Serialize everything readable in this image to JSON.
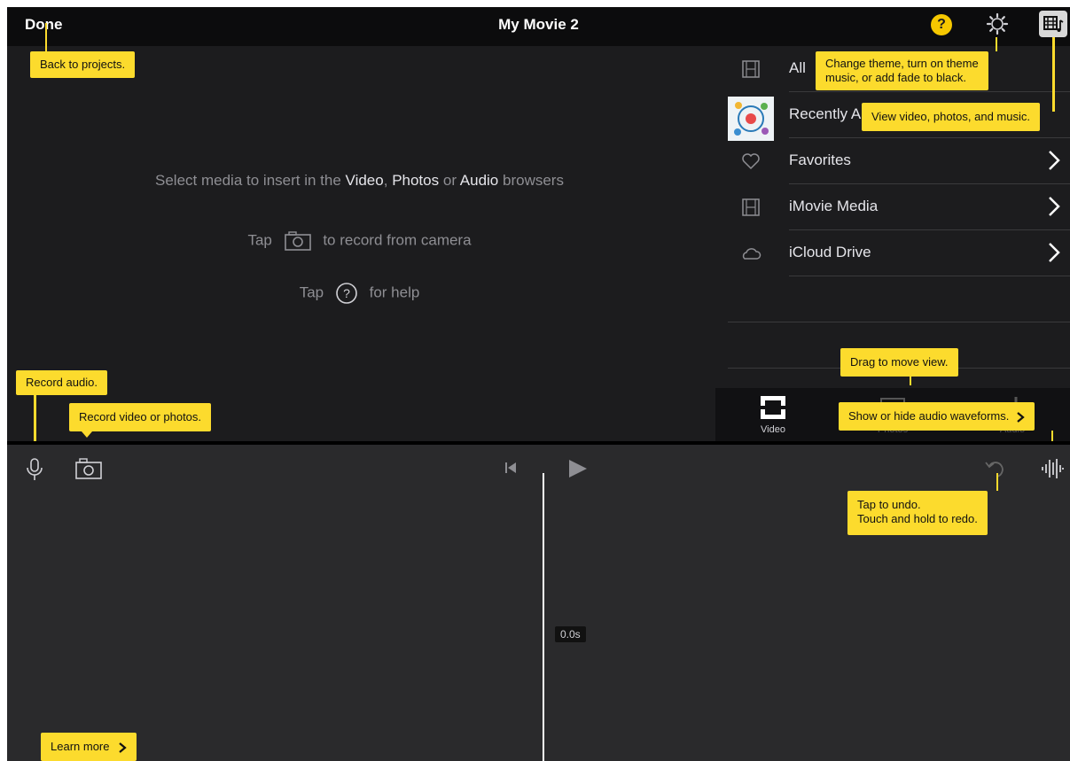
{
  "header": {
    "done_label": "Done",
    "title": "My Movie 2",
    "help_symbol": "?"
  },
  "viewer": {
    "hint_prefix": "Select media to insert in the",
    "hint_video": "Video",
    "hint_sep": ",",
    "hint_photos": "Photos",
    "hint_or": "or",
    "hint_audio": "Audio",
    "hint_suffix": "browsers",
    "camera_tap": "Tap",
    "camera_text": "to record from camera",
    "help_tap": "Tap",
    "help_text": "for help"
  },
  "browser": {
    "items": [
      {
        "label": "All",
        "icon": "film-icon"
      },
      {
        "label": "Recently A",
        "icon": "thumbnail"
      },
      {
        "label": "Favorites",
        "icon": "heart-icon"
      },
      {
        "label": "iMovie Media",
        "icon": "film-icon"
      },
      {
        "label": "iCloud Drive",
        "icon": "cloud-icon"
      }
    ],
    "tabs": [
      {
        "label": "Video",
        "icon": "video-tab-icon"
      },
      {
        "label": "Photos",
        "icon": "photos-tab-icon"
      },
      {
        "label": "Audio",
        "icon": "audio-tab-icon"
      }
    ]
  },
  "timeline": {
    "time": "0.0s"
  },
  "tips": {
    "back": "Back to projects.",
    "theme_line1": "Change theme, turn on theme",
    "theme_line2": "music, or add fade to black.",
    "media": "View video, photos, and music.",
    "record_audio": "Record audio.",
    "record_video": "Record video or photos.",
    "drag": "Drag to move view.",
    "waveforms": "Show or hide audio waveforms.",
    "undo_line1": "Tap to undo.",
    "undo_line2": "Touch and hold to redo.",
    "learn_more": "Learn more"
  },
  "colors": {
    "accent_yellow": "#fcdb2d",
    "help_yellow": "#f6c800",
    "background": "#1c1c1e"
  }
}
